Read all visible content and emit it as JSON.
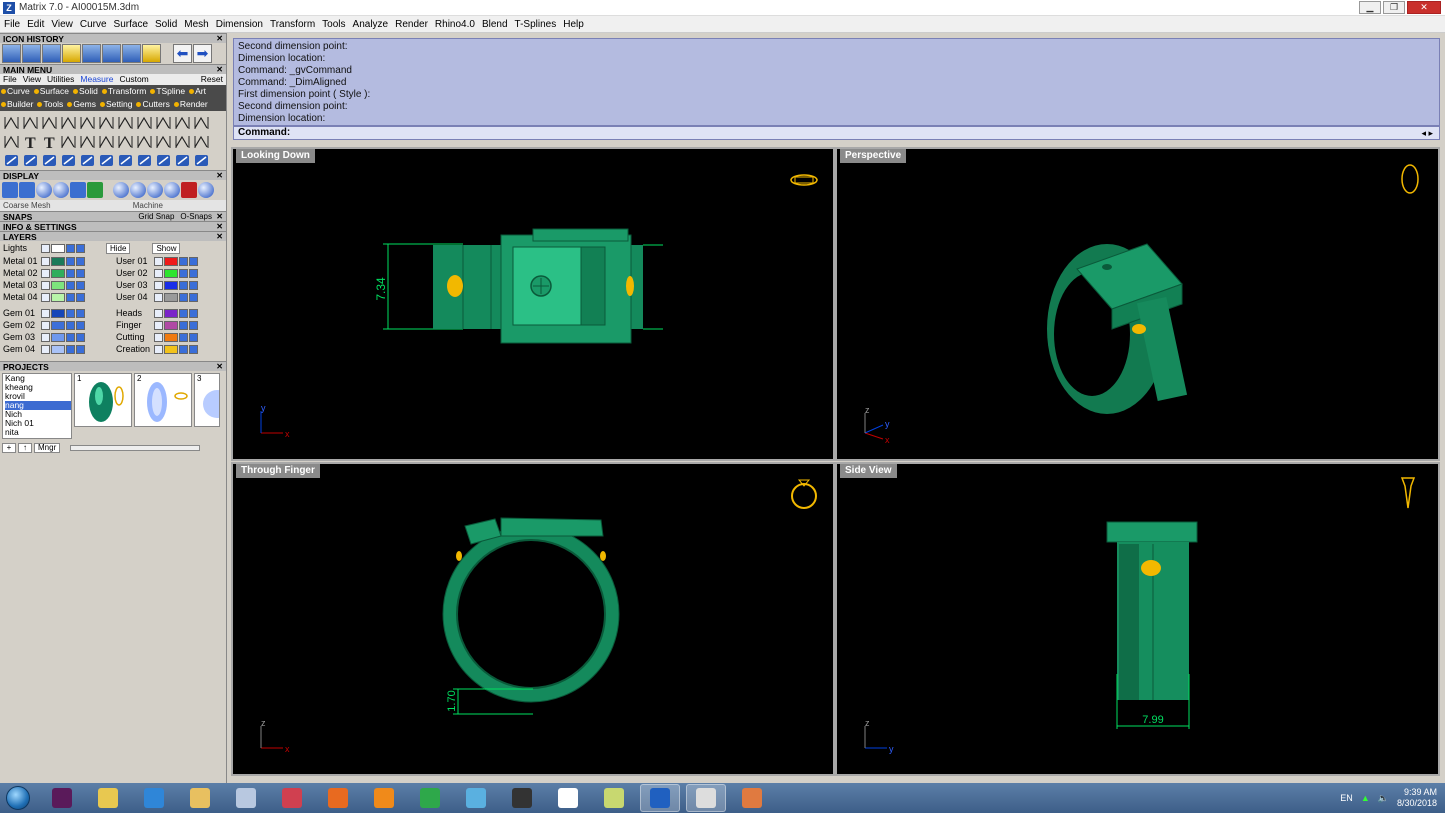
{
  "window": {
    "title": "Matrix 7.0 - AI00015M.3dm"
  },
  "menu": [
    "File",
    "Edit",
    "View",
    "Curve",
    "Surface",
    "Solid",
    "Mesh",
    "Dimension",
    "Transform",
    "Tools",
    "Analyze",
    "Render",
    "Rhino4.0",
    "Blend",
    "T-Splines",
    "Help"
  ],
  "panel": {
    "icon_history": "ICON HISTORY",
    "main_menu": "MAIN MENU",
    "main_tabs": [
      "File",
      "View",
      "Utilities",
      "Measure",
      "Custom"
    ],
    "reset": "Reset",
    "cat_row1": [
      "Curve",
      "Surface",
      "Solid",
      "Transform",
      "TSpline",
      "Art"
    ],
    "cat_row2": [
      "Builder",
      "Tools",
      "Gems",
      "Setting",
      "Cutters",
      "Render"
    ],
    "display": "DISPLAY",
    "display_left": "Coarse Mesh",
    "display_right": "Machine",
    "snaps": "SNAPS",
    "grid_snap": "Grid Snap",
    "o_snaps": "O-Snaps",
    "info": "INFO & SETTINGS",
    "layers": "LAYERS",
    "lights": "Lights",
    "hide": "Hide",
    "show": "Show",
    "layers_left": [
      {
        "name": "Metal 01",
        "color": "#1a7a5a"
      },
      {
        "name": "Metal 02",
        "color": "#2fae5d"
      },
      {
        "name": "Metal 03",
        "color": "#7de57d"
      },
      {
        "name": "Metal 04",
        "color": "#b8f4a8"
      },
      {
        "name": "Gem 01",
        "color": "#1646b8"
      },
      {
        "name": "Gem 02",
        "color": "#3d6fd8"
      },
      {
        "name": "Gem 03",
        "color": "#6e98ee"
      },
      {
        "name": "Gem 04",
        "color": "#a9c2f7"
      }
    ],
    "layers_right": [
      {
        "name": "User 01",
        "color": "#ee1a1a"
      },
      {
        "name": "User 02",
        "color": "#2ee42e"
      },
      {
        "name": "User 03",
        "color": "#1a2ee8"
      },
      {
        "name": "User 04",
        "color": "#9a9a9a"
      },
      {
        "name": "Heads",
        "color": "#7a24c8"
      },
      {
        "name": "Finger",
        "color": "#b04aa4"
      },
      {
        "name": "Cutting",
        "color": "#f07a10"
      },
      {
        "name": "Creation",
        "color": "#f2c21a"
      }
    ],
    "projects": "PROJECTS",
    "project_list": [
      "Kang",
      "kheang",
      "krovil",
      "nang",
      "Nich",
      "Nich 01",
      "nita"
    ],
    "project_selected": "nang",
    "thumb_numbers": [
      "1",
      "2",
      "3"
    ],
    "mngr": "Mngr"
  },
  "command_history": [
    "Second dimension point:",
    "Dimension location:",
    "Command: _gvCommand",
    "Command: _DimAligned",
    "First dimension point ( Style ):",
    "Second dimension point:",
    "Dimension location:"
  ],
  "command_label": "Command:",
  "viewports": {
    "top": {
      "label": "Looking Down",
      "dim": "7.34"
    },
    "persp": {
      "label": "Perspective"
    },
    "front": {
      "label": "Through Finger",
      "dim": "1.70"
    },
    "side": {
      "label": "Side View",
      "dim": "7.99"
    }
  },
  "axes": {
    "x": "x",
    "y": "y",
    "z": "z"
  },
  "taskbar": {
    "apps": [
      "premiere-icon",
      "folder-icon",
      "ie-icon",
      "explorer-icon",
      "calculator-icon",
      "snipping-icon",
      "firefox-icon",
      "media-icon",
      "chrome-icon",
      "eraser-icon",
      "stylus-icon",
      "runner-icon",
      "notes-icon",
      "matrix-icon",
      "rhino-icon",
      "paint-icon"
    ],
    "lang": "EN",
    "time": "9:39 AM",
    "date": "8/30/2018"
  },
  "colors": {
    "ring": "#1a8a5c",
    "gold": "#f2b800",
    "dim": "#00e060"
  }
}
